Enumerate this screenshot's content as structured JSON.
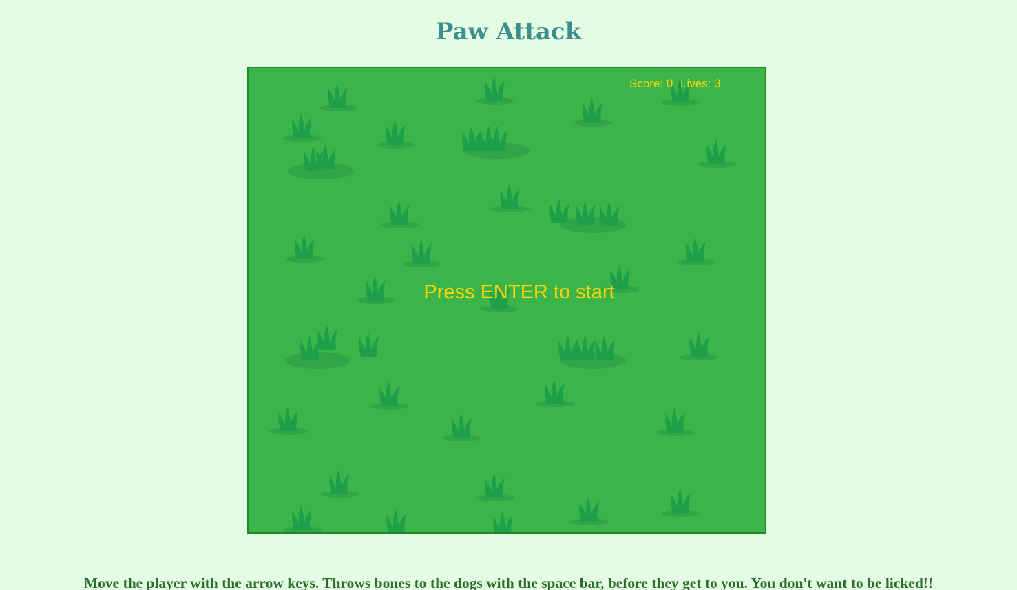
{
  "page": {
    "title": "Paw Attack",
    "instructions": "Move the player with the arrow keys. Throws bones to the dogs with the space bar, before they get to you. You don't want to be licked!!"
  },
  "game": {
    "score_label": "Score: 0",
    "lives_label": "Lives: 3",
    "start_message": "Press ENTER to start",
    "state": "waiting-for-enter"
  },
  "colors": {
    "page_background": "#e4fce4",
    "title": "#3d8f8f",
    "instructions": "#2c6e2c",
    "canvas_grass": "#3bb54a",
    "canvas_border": "#1c8a24",
    "grass_tuft": "#1ea04a",
    "grass_shadow": "#31a547",
    "hud_text": "#ffd400"
  },
  "icons": {
    "grass_tuft": "grass-tuft-icon"
  }
}
